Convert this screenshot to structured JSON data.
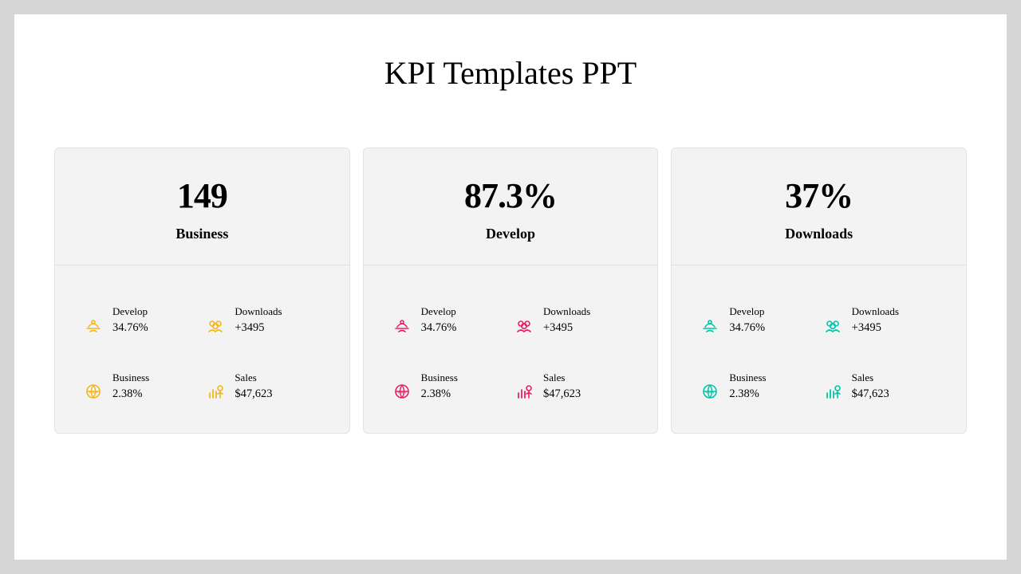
{
  "title": "KPI Templates PPT",
  "colors": {
    "yellow": "#f2b81a",
    "pink": "#ea1e63",
    "teal": "#00c4a7"
  },
  "cards": [
    {
      "value": "149",
      "label": "Business",
      "icon_color": "c-yellow",
      "metrics": [
        {
          "label": "Develop",
          "value": "34.76%",
          "icon": "develop-icon"
        },
        {
          "label": "Downloads",
          "value": "+3495",
          "icon": "downloads-icon"
        },
        {
          "label": "Business",
          "value": "2.38%",
          "icon": "business-icon"
        },
        {
          "label": "Sales",
          "value": "$47,623",
          "icon": "sales-icon"
        }
      ]
    },
    {
      "value": "87.3%",
      "label": "Develop",
      "icon_color": "c-pink",
      "metrics": [
        {
          "label": "Develop",
          "value": "34.76%",
          "icon": "develop-icon"
        },
        {
          "label": "Downloads",
          "value": "+3495",
          "icon": "downloads-icon"
        },
        {
          "label": "Business",
          "value": "2.38%",
          "icon": "business-icon"
        },
        {
          "label": "Sales",
          "value": "$47,623",
          "icon": "sales-icon"
        }
      ]
    },
    {
      "value": "37%",
      "label": "Downloads",
      "icon_color": "c-teal",
      "metrics": [
        {
          "label": "Develop",
          "value": "34.76%",
          "icon": "develop-icon"
        },
        {
          "label": "Downloads",
          "value": "+3495",
          "icon": "downloads-icon"
        },
        {
          "label": "Business",
          "value": "2.38%",
          "icon": "business-icon"
        },
        {
          "label": "Sales",
          "value": "$47,623",
          "icon": "sales-icon"
        }
      ]
    }
  ]
}
